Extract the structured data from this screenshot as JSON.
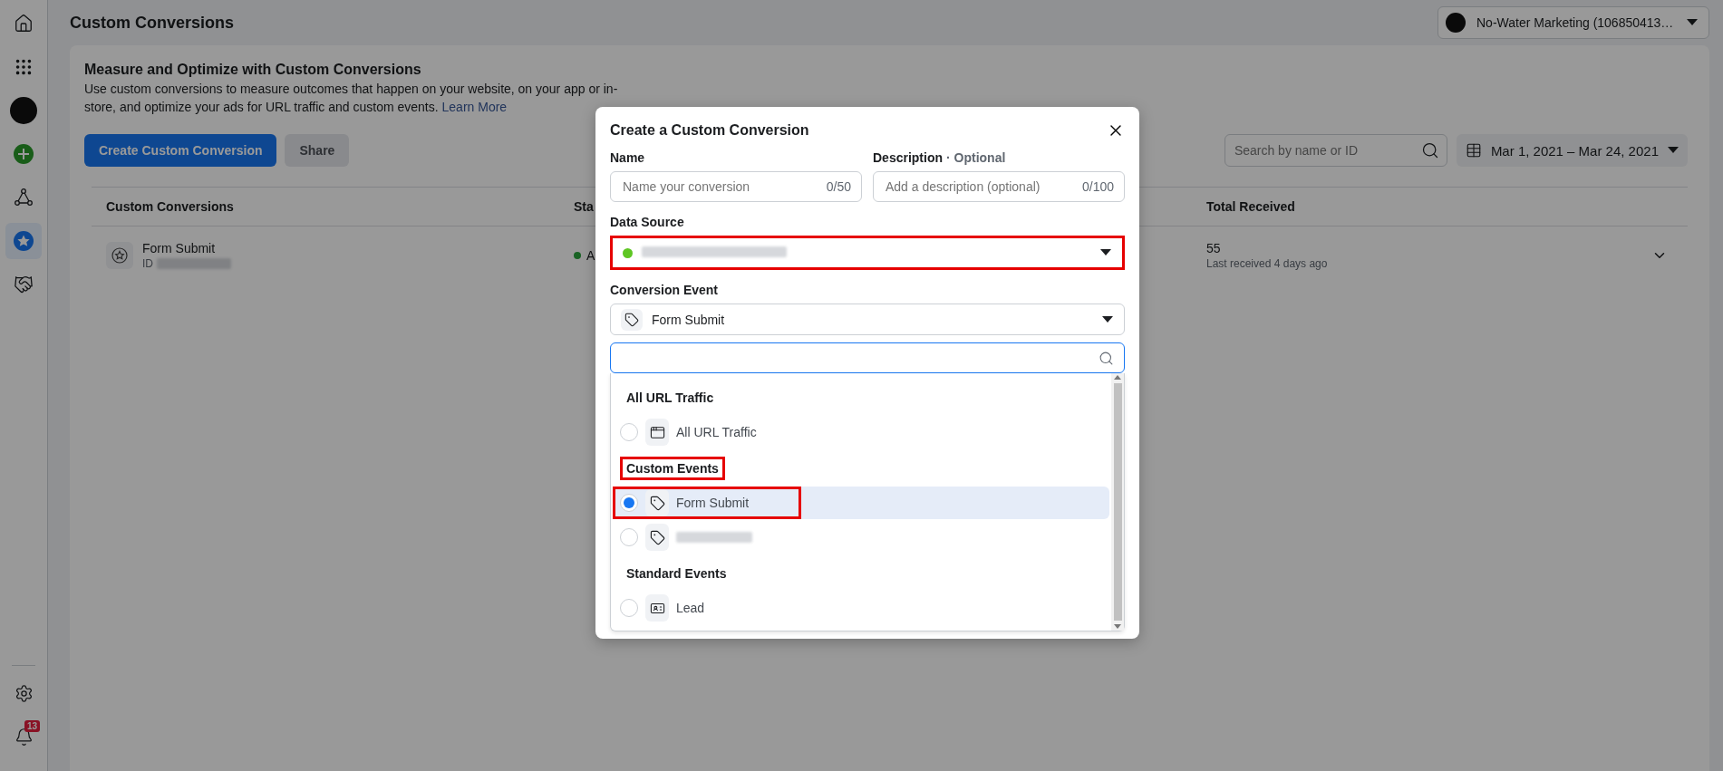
{
  "page_title": "Custom Conversions",
  "account": {
    "name": "No-Water Marketing (106850413…"
  },
  "sidebar": {
    "items": [
      {
        "selected": false
      },
      {
        "selected": false
      },
      {
        "selected": false
      },
      {
        "selected": false
      },
      {
        "selected": false
      },
      {
        "selected": true
      },
      {
        "selected": false
      }
    ],
    "notifications_badge": "13"
  },
  "intro": {
    "heading": "Measure and Optimize with Custom Conversions",
    "text": "Use custom conversions to measure outcomes that happen on your website, on your app or in-store, and optimize your ads for URL traffic and custom events.",
    "link": "Learn More"
  },
  "actions": [
    {
      "label": "Create Custom Conversion",
      "primary": true
    },
    {
      "label": "Share",
      "primary": false
    }
  ],
  "search": {
    "placeholder": "Search by name or ID"
  },
  "date_range": "Mar 1, 2021 – Mar 24, 2021",
  "table": {
    "columns": [
      "Custom Conversions",
      "Sta",
      "Total Received"
    ],
    "rows": [
      {
        "name": "Form Submit",
        "id_label": "ID",
        "status": "A",
        "total": "55",
        "last_received": "Last received 4 days ago"
      }
    ]
  },
  "modal": {
    "title": "Create a Custom Conversion",
    "fields": [
      {
        "label": "Name",
        "placeholder": "Name your conversion",
        "counter": "0/50"
      },
      {
        "label": "Description",
        "note": "· Optional",
        "placeholder": "Add a description (optional)",
        "counter": "0/100"
      }
    ],
    "data_source": {
      "label": "Data Source",
      "highlighted": true
    },
    "conversion_event": {
      "label": "Conversion Event",
      "value": "Form Submit"
    },
    "event_search": {
      "focused": true
    },
    "event_groups": [
      {
        "heading": "All URL Traffic",
        "highlighted": false,
        "items": [
          {
            "kind": "page",
            "label": "All URL Traffic",
            "selected": false,
            "highlighted": false
          }
        ]
      },
      {
        "heading": "Custom Events",
        "highlighted": true,
        "items": [
          {
            "kind": "custom",
            "label": "Form Submit",
            "selected": true,
            "highlighted": true
          },
          {
            "kind": "custom",
            "redacted": true,
            "selected": false,
            "highlighted": false
          }
        ]
      },
      {
        "heading": "Standard Events",
        "highlighted": false,
        "items": [
          {
            "kind": "standard",
            "label": "Lead",
            "selected": false,
            "highlighted": false
          }
        ]
      }
    ]
  }
}
